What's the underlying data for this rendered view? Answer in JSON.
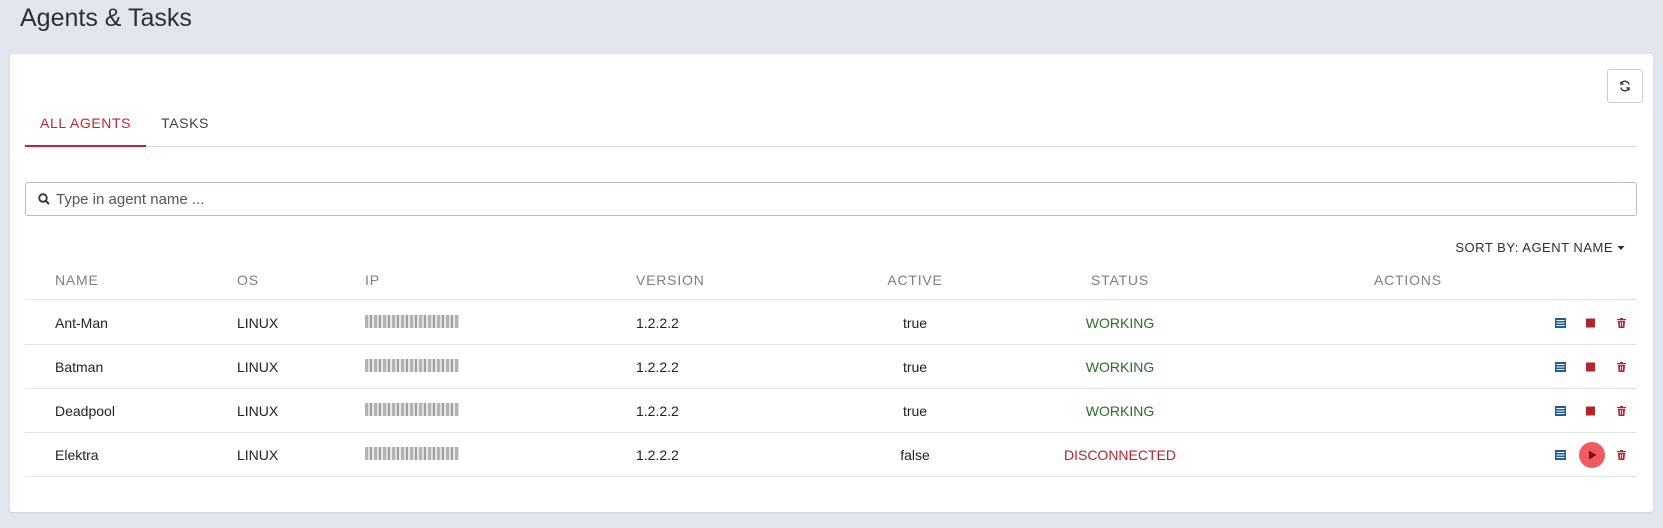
{
  "page": {
    "title": "Agents & Tasks"
  },
  "tabs": [
    {
      "label": "ALL AGENTS",
      "active": true
    },
    {
      "label": "TASKS",
      "active": false
    }
  ],
  "search": {
    "placeholder": "Type in agent name ..."
  },
  "sort": {
    "label": "SORT BY: AGENT NAME"
  },
  "table": {
    "columns": [
      "NAME",
      "OS",
      "IP",
      "VERSION",
      "ACTIVE",
      "STATUS",
      "ACTIONS"
    ],
    "rows": [
      {
        "name": "Ant-Man",
        "os": "LINUX",
        "version": "1.2.2.2",
        "active": "true",
        "status": "WORKING"
      },
      {
        "name": "Batman",
        "os": "LINUX",
        "version": "1.2.2.2",
        "active": "true",
        "status": "WORKING"
      },
      {
        "name": "Deadpool",
        "os": "LINUX",
        "version": "1.2.2.2",
        "active": "true",
        "status": "WORKING"
      },
      {
        "name": "Elektra",
        "os": "LINUX",
        "version": "1.2.2.2",
        "active": "false",
        "status": "DISCONNECTED"
      }
    ]
  },
  "icons": {
    "refresh": "refresh-icon",
    "search": "search-icon",
    "sort_caret": "caret-down-icon",
    "logs": "log-icon",
    "stop": "stop-icon",
    "play": "play-icon",
    "delete": "trash-icon"
  },
  "colors": {
    "accent": "#cc1f2e",
    "working": "#2e6b2a",
    "disconnected": "#b4232e",
    "play_bg": "#f05b62",
    "background": "#e1e5ee"
  }
}
